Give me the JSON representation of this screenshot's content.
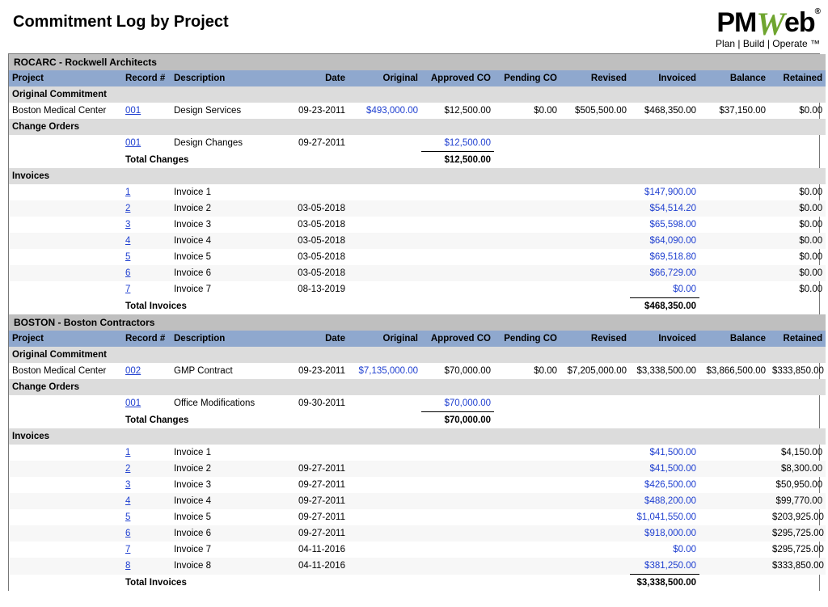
{
  "title": "Commitment Log by Project",
  "logo": {
    "brand_pm": "PM",
    "brand_w": "W",
    "brand_eb": "eb",
    "reg": "®",
    "tagline": "Plan | Build | Operate ™"
  },
  "columns": {
    "project": "Project",
    "record": "Record #",
    "description": "Description",
    "date": "Date",
    "original": "Original",
    "approved": "Approved CO",
    "pending": "Pending CO",
    "revised": "Revised",
    "invoiced": "Invoiced",
    "balance": "Balance",
    "retained": "Retained"
  },
  "sections": {
    "orig": "Original Commitment",
    "chg": "Change Orders",
    "inv": "Invoices",
    "totchg": "Total Changes",
    "totinv": "Total Invoices"
  },
  "groups": [
    {
      "heading": "ROCARC - Rockwell Architects",
      "commitments": [
        {
          "project": "Boston Medical Center",
          "record": "001",
          "description": "Design Services",
          "date": "09-23-2011",
          "original": "$493,000.00",
          "approved": "$12,500.00",
          "pending": "$0.00",
          "revised": "$505,500.00",
          "invoiced": "$468,350.00",
          "balance": "$37,150.00",
          "retained": "$0.00"
        }
      ],
      "changes": [
        {
          "record": "001",
          "description": "Design Changes",
          "date": "09-27-2011",
          "approved": "$12,500.00"
        }
      ],
      "changes_total": {
        "approved": "$12,500.00"
      },
      "invoices": [
        {
          "record": "1",
          "description": "Invoice 1",
          "date": "",
          "invoiced": "$147,900.00",
          "retained": "$0.00"
        },
        {
          "record": "2",
          "description": "Invoice 2",
          "date": "03-05-2018",
          "invoiced": "$54,514.20",
          "retained": "$0.00"
        },
        {
          "record": "3",
          "description": "Invoice 3",
          "date": "03-05-2018",
          "invoiced": "$65,598.00",
          "retained": "$0.00"
        },
        {
          "record": "4",
          "description": "Invoice 4",
          "date": "03-05-2018",
          "invoiced": "$64,090.00",
          "retained": "$0.00"
        },
        {
          "record": "5",
          "description": "Invoice 5",
          "date": "03-05-2018",
          "invoiced": "$69,518.80",
          "retained": "$0.00"
        },
        {
          "record": "6",
          "description": "Invoice 6",
          "date": "03-05-2018",
          "invoiced": "$66,729.00",
          "retained": "$0.00"
        },
        {
          "record": "7",
          "description": "Invoice 7",
          "date": "08-13-2019",
          "invoiced": "$0.00",
          "retained": "$0.00"
        }
      ],
      "invoices_total": {
        "invoiced": "$468,350.00"
      }
    },
    {
      "heading": "BOSTON - Boston Contractors",
      "commitments": [
        {
          "project": "Boston Medical Center",
          "record": "002",
          "description": "GMP Contract",
          "date": "09-23-2011",
          "original": "$7,135,000.00",
          "approved": "$70,000.00",
          "pending": "$0.00",
          "revised": "$7,205,000.00",
          "invoiced": "$3,338,500.00",
          "balance": "$3,866,500.00",
          "retained": "$333,850.00"
        }
      ],
      "changes": [
        {
          "record": "001",
          "description": "Office Modifications",
          "date": "09-30-2011",
          "approved": "$70,000.00"
        }
      ],
      "changes_total": {
        "approved": "$70,000.00"
      },
      "invoices": [
        {
          "record": "1",
          "description": "Invoice 1",
          "date": "",
          "invoiced": "$41,500.00",
          "retained": "$4,150.00"
        },
        {
          "record": "2",
          "description": "Invoice 2",
          "date": "09-27-2011",
          "invoiced": "$41,500.00",
          "retained": "$8,300.00"
        },
        {
          "record": "3",
          "description": "Invoice 3",
          "date": "09-27-2011",
          "invoiced": "$426,500.00",
          "retained": "$50,950.00"
        },
        {
          "record": "4",
          "description": "Invoice 4",
          "date": "09-27-2011",
          "invoiced": "$488,200.00",
          "retained": "$99,770.00"
        },
        {
          "record": "5",
          "description": "Invoice 5",
          "date": "09-27-2011",
          "invoiced": "$1,041,550.00",
          "retained": "$203,925.00"
        },
        {
          "record": "6",
          "description": "Invoice 6",
          "date": "09-27-2011",
          "invoiced": "$918,000.00",
          "retained": "$295,725.00"
        },
        {
          "record": "7",
          "description": "Invoice 7",
          "date": "04-11-2016",
          "invoiced": "$0.00",
          "retained": "$295,725.00"
        },
        {
          "record": "8",
          "description": "Invoice 8",
          "date": "04-11-2016",
          "invoiced": "$381,250.00",
          "retained": "$333,850.00"
        }
      ],
      "invoices_total": {
        "invoiced": "$3,338,500.00"
      }
    }
  ]
}
